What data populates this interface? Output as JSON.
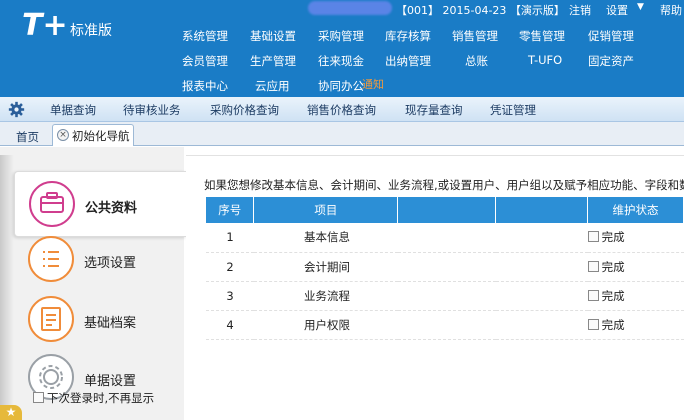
{
  "header": {
    "logo_mark": "T+",
    "edition": "标准版",
    "session_info": "【001】 2015-04-23 【演示版】",
    "logout": "注销",
    "settings": "设置",
    "help": "帮助",
    "notice": "通知"
  },
  "menu": [
    "系统管理",
    "基础设置",
    "采购管理",
    "库存核算",
    "销售管理",
    "零售管理",
    "促销管理",
    "会员管理",
    "生产管理",
    "往来现金",
    "出纳管理",
    "总账",
    "T-UFO",
    "固定资产",
    "报表中心",
    "云应用",
    "协同办公"
  ],
  "quickbar": [
    "单据查询",
    "待审核业务",
    "采购价格查询",
    "销售价格查询",
    "现存量查询",
    "凭证管理"
  ],
  "tabs": {
    "home": "首页",
    "init": "初始化导航"
  },
  "nav": [
    {
      "label": "公共资料",
      "icon": "briefcase-icon"
    },
    {
      "label": "选项设置",
      "icon": "list-icon"
    },
    {
      "label": "基础档案",
      "icon": "document-icon"
    },
    {
      "label": "单据设置",
      "icon": "gear-icon"
    }
  ],
  "main": {
    "intro": "如果您想修改基本信息、会计期间、业务流程,或设置用户、用户组以及赋予相应功能、字段和数",
    "columns": [
      "序号",
      "项目",
      "",
      "",
      "维护状态"
    ],
    "rows": [
      {
        "seq": "1",
        "item": "基本信息",
        "status": "完成"
      },
      {
        "seq": "2",
        "item": "会计期间",
        "status": "完成"
      },
      {
        "seq": "3",
        "item": "业务流程",
        "status": "完成"
      },
      {
        "seq": "4",
        "item": "用户权限",
        "status": "完成"
      }
    ]
  },
  "footer": {
    "dont_show": "下次登录时,不再显示"
  },
  "colors": {
    "header_bg": "#1a7cc6",
    "grid_header": "#2c8fd6",
    "accent_pink": "#d03d8e",
    "accent_orange": "#f08c3a"
  }
}
